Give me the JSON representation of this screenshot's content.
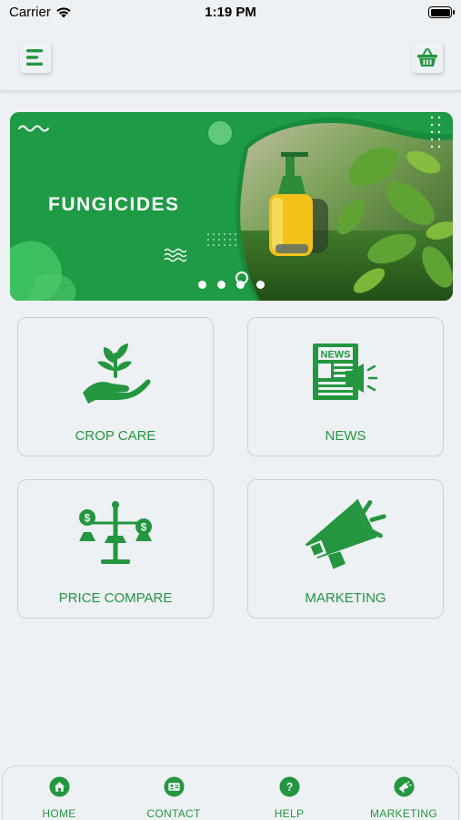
{
  "status": {
    "carrier": "Carrier",
    "time": "1:19 PM"
  },
  "header": {
    "menu_icon": "hamburger-menu-icon",
    "basket_icon": "basket-icon"
  },
  "banner": {
    "title": "FUNGICIDES",
    "dots": 4,
    "active_dot": 3
  },
  "tiles": [
    {
      "label": "CROP CARE",
      "icon": "plant-in-hand-icon"
    },
    {
      "label": "NEWS",
      "icon": "newspaper-icon"
    },
    {
      "label": "PRICE COMPARE",
      "icon": "price-scale-icon"
    },
    {
      "label": "MARKETING",
      "icon": "megaphone-icon"
    }
  ],
  "nav": [
    {
      "label": "HOME",
      "icon": "home-icon"
    },
    {
      "label": "CONTACT",
      "icon": "contact-card-icon"
    },
    {
      "label": "HELP",
      "icon": "help-icon"
    },
    {
      "label": "MARKETING",
      "icon": "megaphone-icon"
    }
  ],
  "colors": {
    "brand_green": "#23963f",
    "background": "#eef1f4"
  }
}
